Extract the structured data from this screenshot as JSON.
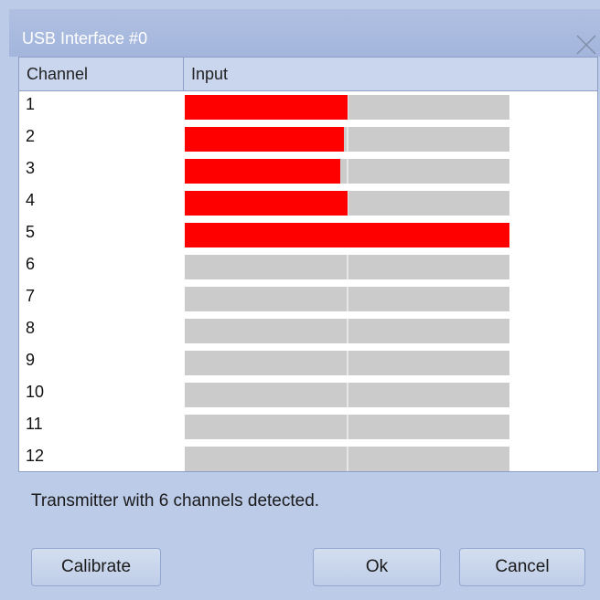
{
  "dialog": {
    "title": "USB Interface #0",
    "close_icon": "close-icon"
  },
  "table": {
    "columns": [
      "Channel",
      "Input"
    ],
    "rows": [
      {
        "channel": "1",
        "level": 0.5
      },
      {
        "channel": "2",
        "level": 0.49
      },
      {
        "channel": "3",
        "level": 0.48
      },
      {
        "channel": "4",
        "level": 0.5
      },
      {
        "channel": "5",
        "level": 1.0
      },
      {
        "channel": "6",
        "level": 0
      },
      {
        "channel": "7",
        "level": 0
      },
      {
        "channel": "8",
        "level": 0
      },
      {
        "channel": "9",
        "level": 0
      },
      {
        "channel": "10",
        "level": 0
      },
      {
        "channel": "11",
        "level": 0
      },
      {
        "channel": "12",
        "level": 0
      }
    ]
  },
  "status": {
    "message": "Transmitter with 6 channels detected."
  },
  "buttons": {
    "calibrate": "Calibrate",
    "ok": "Ok",
    "cancel": "Cancel"
  },
  "colors": {
    "bar_fill": "#ff0000",
    "bar_track": "#cbcbcb",
    "window_bg": "#bccbe8"
  }
}
